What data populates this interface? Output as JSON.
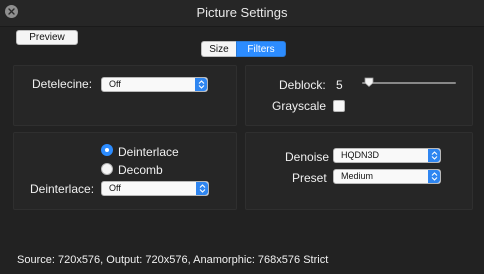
{
  "window": {
    "title": "Picture Settings"
  },
  "toolbar": {
    "preview_label": "Preview"
  },
  "tabs": {
    "size_label": "Size",
    "filters_label": "Filters",
    "selected": "Filters"
  },
  "filters": {
    "detelecine": {
      "label": "Detelecine:",
      "value": "Off"
    },
    "deblock": {
      "label": "Deblock:",
      "value": "5"
    },
    "grayscale": {
      "label": "Grayscale",
      "checked": false
    },
    "deinterlace_mode": {
      "options": [
        {
          "label": "Deinterlace",
          "selected": true
        },
        {
          "label": "Decomb",
          "selected": false
        }
      ]
    },
    "deinterlace": {
      "label": "Deinterlace:",
      "value": "Off"
    },
    "denoise": {
      "label": "Denoise",
      "value": "HQDN3D"
    },
    "preset": {
      "label": "Preset",
      "value": "Medium"
    }
  },
  "status": {
    "text": "Source: 720x576, Output: 720x576, Anamorphic: 768x576 Strict"
  },
  "colors": {
    "accent": "#2c8cff",
    "background": "#222222",
    "text": "#f2f2f2"
  },
  "icons": {
    "close": "close-icon",
    "select_arrow": "select-arrows-icon",
    "slider_thumb": "slider-thumb-icon"
  }
}
